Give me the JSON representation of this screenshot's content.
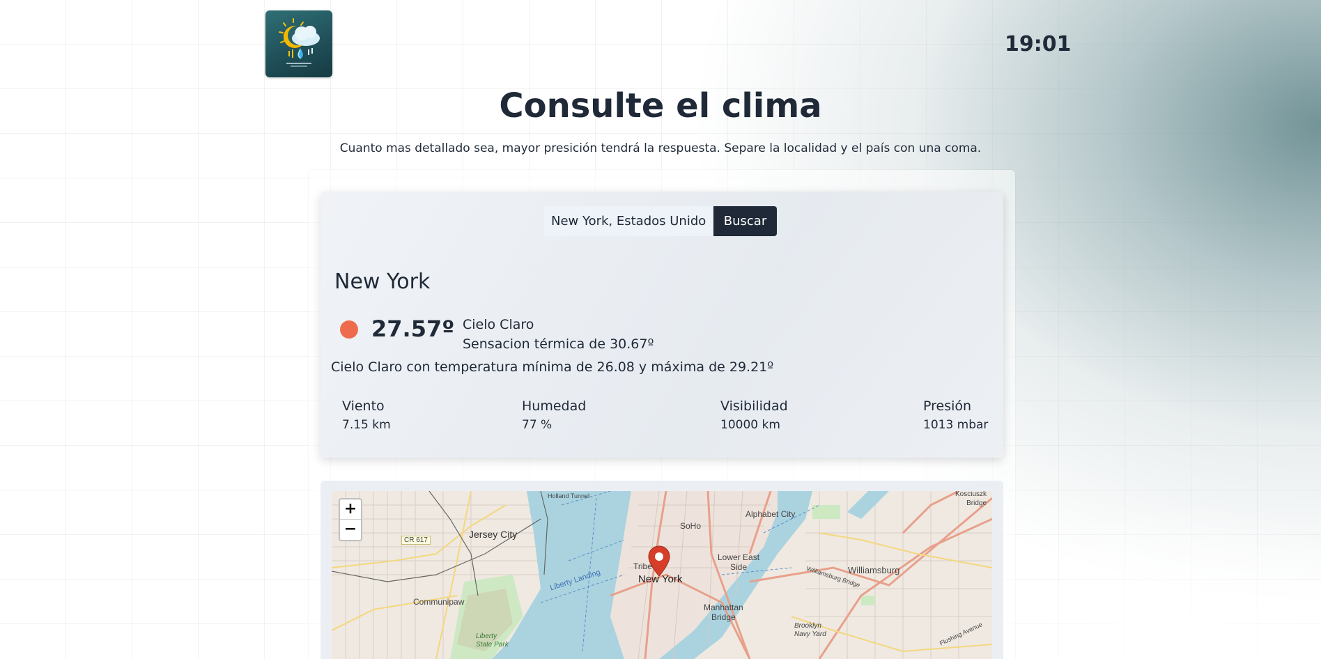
{
  "header": {
    "logo_icon": "weather-logo-icon",
    "clock": "19:01"
  },
  "page": {
    "title": "Consulte el clima",
    "subtitle": "Cuanto mas detallado sea, mayor presición tendrá la respuesta. Separe la localidad y el país con una coma."
  },
  "search": {
    "value": "New York, Estados Unidos",
    "button_label": "Buscar"
  },
  "weather": {
    "city": "New York",
    "indicator_color": "#ee6c4d",
    "temperature": "27.57º",
    "condition": "Cielo Claro",
    "feels_like": "Sensacion térmica de 30.67º",
    "summary": "Cielo Claro con temperatura mínima de 26.08 y máxima de 29.21º",
    "stats": [
      {
        "label": "Viento",
        "value": "7.15 km"
      },
      {
        "label": "Humedad",
        "value": "77 %"
      },
      {
        "label": "Visibilidad",
        "value": "10000 km"
      },
      {
        "label": "Presión",
        "value": "1013 mbar"
      }
    ]
  },
  "map": {
    "zoom_in": "+",
    "zoom_out": "−",
    "labels": {
      "jersey_city": "Jersey City",
      "cr617": "CR 617",
      "communipaw": "Communipaw",
      "liberty_state_park": "Liberty\nState Park",
      "holland_tunnel": "Holland Tunnel",
      "alphabet_city": "Alphabet City",
      "soho": "SoHo",
      "lower_east_side": "Lower East\nSide",
      "tribeca": "Tribe",
      "new_york": "New York",
      "manhattan_bridge": "Manhattan\nBridge",
      "williamsburg": "Williamsburg",
      "williamsburg_bridge": "Williamsburg Bridge",
      "brooklyn_navy_yard": "Brooklyn\nNavy Yard",
      "kosciuszko_bridge": "Kosciuszk\nBridge",
      "flushing_avenue": "Flushing Avenue",
      "liberty_landing": "Liberty Landing"
    },
    "marker_color": "#d63e2a"
  }
}
